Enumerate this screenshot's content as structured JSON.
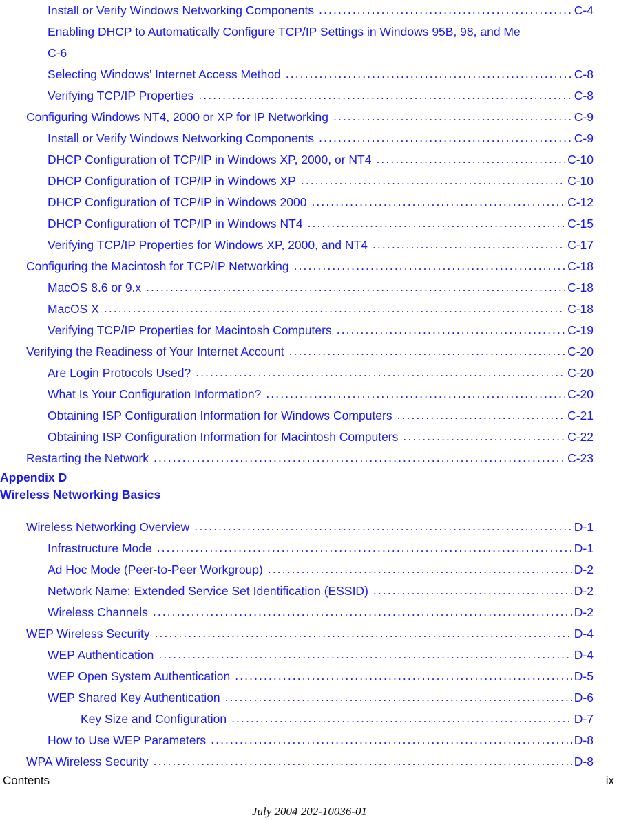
{
  "document": {
    "leader_char": "."
  },
  "toc": {
    "entries": [
      {
        "level": 2,
        "title": "Install or Verify Windows Networking Components",
        "page": "C-4",
        "wrapped": false
      },
      {
        "level": 2,
        "title": "Enabling DHCP to Automatically Configure TCP/IP Settings in Windows 95B, 98, and Me",
        "page": "C-6",
        "wrapped": true
      },
      {
        "level": 2,
        "title": "Selecting Windows’ Internet Access Method",
        "page": "C-8",
        "wrapped": false
      },
      {
        "level": 2,
        "title": "Verifying TCP/IP Properties",
        "page": "C-8",
        "wrapped": false
      },
      {
        "level": 1,
        "title": "Configuring Windows NT4, 2000 or XP for IP Networking",
        "page": "C-9",
        "wrapped": false
      },
      {
        "level": 2,
        "title": "Install or Verify Windows Networking Components",
        "page": "C-9",
        "wrapped": false
      },
      {
        "level": 2,
        "title": "DHCP Configuration of TCP/IP in Windows XP, 2000, or NT4",
        "page": "C-10",
        "wrapped": false
      },
      {
        "level": 2,
        "title": "DHCP Configuration of TCP/IP in Windows XP",
        "page": "C-10",
        "wrapped": false
      },
      {
        "level": 2,
        "title": "DHCP Configuration of TCP/IP in Windows 2000",
        "page": "C-12",
        "wrapped": false
      },
      {
        "level": 2,
        "title": "DHCP Configuration of TCP/IP in Windows NT4",
        "page": "C-15",
        "wrapped": false
      },
      {
        "level": 2,
        "title": "Verifying TCP/IP Properties for Windows XP, 2000, and NT4",
        "page": "C-17",
        "wrapped": false
      },
      {
        "level": 1,
        "title": "Configuring the Macintosh for TCP/IP Networking",
        "page": "C-18",
        "wrapped": false
      },
      {
        "level": 2,
        "title": "MacOS 8.6 or 9.x",
        "page": "C-18",
        "wrapped": false
      },
      {
        "level": 2,
        "title": "MacOS X",
        "page": "C-18",
        "wrapped": false
      },
      {
        "level": 2,
        "title": "Verifying TCP/IP Properties for Macintosh Computers",
        "page": "C-19",
        "wrapped": false
      },
      {
        "level": 1,
        "title": "Verifying the Readiness of Your Internet Account",
        "page": "C-20",
        "wrapped": false
      },
      {
        "level": 2,
        "title": "Are Login Protocols Used?",
        "page": "C-20",
        "wrapped": false
      },
      {
        "level": 2,
        "title": "What Is Your Configuration Information?",
        "page": "C-20",
        "wrapped": false
      },
      {
        "level": 2,
        "title": "Obtaining ISP Configuration Information for Windows Computers",
        "page": "C-21",
        "wrapped": false
      },
      {
        "level": 2,
        "title": "Obtaining ISP Configuration Information for Macintosh Computers",
        "page": "C-22",
        "wrapped": false
      },
      {
        "level": 1,
        "title": "Restarting the Network",
        "page": "C-23",
        "wrapped": false
      }
    ]
  },
  "appendix": {
    "label": "Appendix D",
    "title": "Wireless Networking Basics"
  },
  "toc2": {
    "entries": [
      {
        "level": 1,
        "title": "Wireless Networking Overview",
        "page": "D-1",
        "wrapped": false
      },
      {
        "level": 2,
        "title": "Infrastructure Mode",
        "page": "D-1",
        "wrapped": false
      },
      {
        "level": 2,
        "title": "Ad Hoc Mode (Peer-to-Peer Workgroup)",
        "page": "D-2",
        "wrapped": false
      },
      {
        "level": 2,
        "title": "Network Name: Extended Service Set Identification (ESSID)",
        "page": "D-2",
        "wrapped": false
      },
      {
        "level": 2,
        "title": "Wireless Channels",
        "page": "D-2",
        "wrapped": false
      },
      {
        "level": 1,
        "title": "WEP Wireless Security",
        "page": "D-4",
        "wrapped": false
      },
      {
        "level": 2,
        "title": "WEP Authentication",
        "page": "D-4",
        "wrapped": false
      },
      {
        "level": 2,
        "title": "WEP Open System Authentication",
        "page": "D-5",
        "wrapped": false
      },
      {
        "level": 2,
        "title": "WEP Shared Key Authentication",
        "page": "D-6",
        "wrapped": false
      },
      {
        "level": 3,
        "title": "Key Size and Configuration",
        "page": "D-7",
        "wrapped": false
      },
      {
        "level": 2,
        "title": "How to Use WEP Parameters",
        "page": "D-8",
        "wrapped": false
      },
      {
        "level": 1,
        "title": "WPA Wireless Security",
        "page": "D-8",
        "wrapped": false
      }
    ]
  },
  "footer": {
    "left": "Contents",
    "right": "ix",
    "center": "July 2004 202-10036-01"
  },
  "colors": {
    "toc_link": "#1a1aee",
    "footer_text": "#111111",
    "background": "#ffffff"
  }
}
